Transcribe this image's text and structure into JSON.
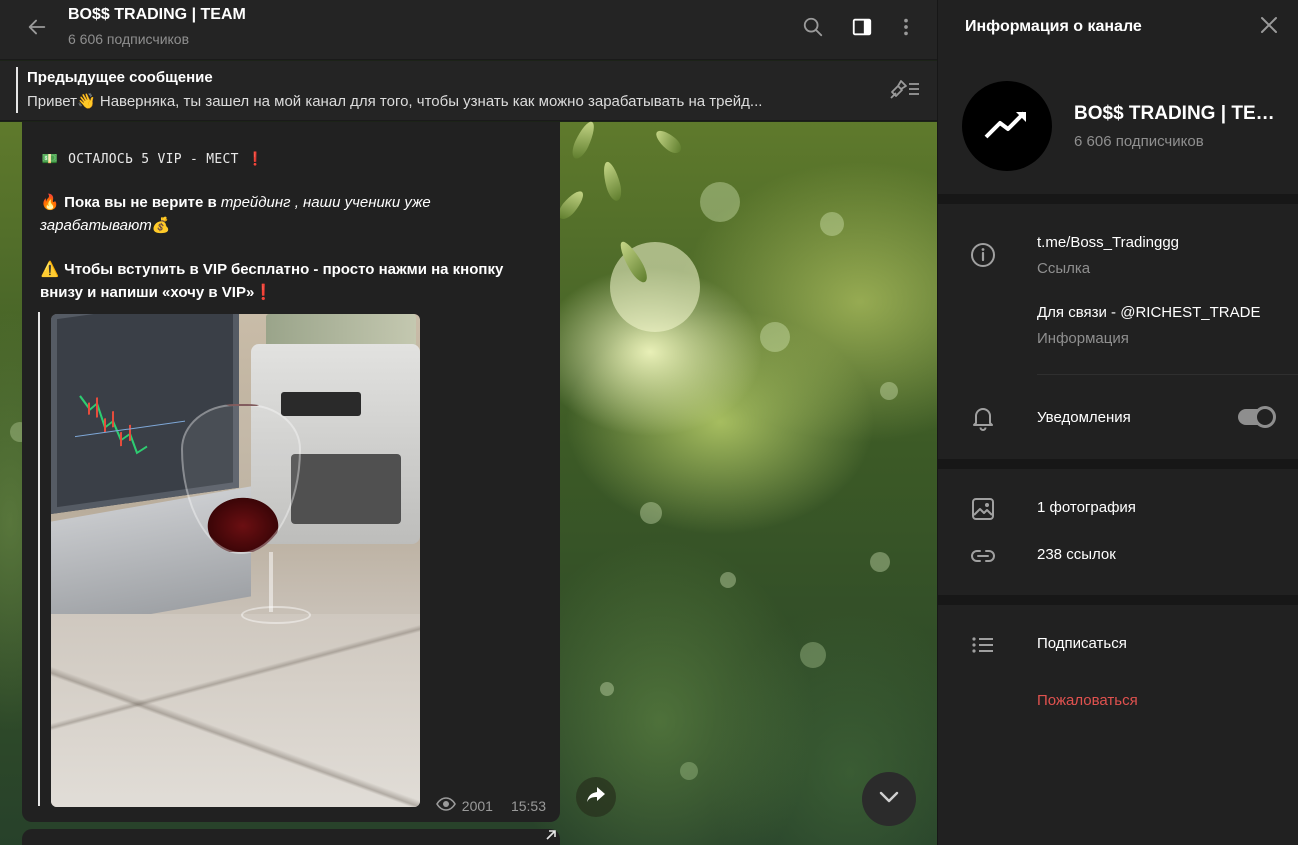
{
  "header": {
    "title": "BO$$ TRADING | TEAM",
    "subscribers": "6 606 подписчиков"
  },
  "pinned": {
    "label": "Предыдущее сообщение",
    "text": "Привет👋    Наверняка, ты зашел на мой канал для того, чтобы узнать как можно зарабатывать на трейд..."
  },
  "message": {
    "line1_emoji": "💵",
    "line1_text": "ОСТАЛОСЬ 5 VIP - МЕСТ",
    "line1_end": "❗",
    "line2_emoji": "🔥",
    "line2_bold": "Пока вы не верите в",
    "line2_italic": "трейдинг , наши ученики уже",
    "line2_italic2": "зарабатывают",
    "line2_end": "💰",
    "line3_emoji": "⚠️",
    "line3_bold": "Чтобы вступить в VIP бесплатно - просто нажми на кнопку",
    "line3_bold2": "внизу и напиши «хочу в VIP»",
    "line3_end": "❗",
    "views": "2001",
    "time": "15:53"
  },
  "panel": {
    "title": "Информация о канале",
    "name": "BO$$ TRADING | TEAM",
    "subscribers": "6 606 подписчиков",
    "link": "t.me/Boss_Tradinggg",
    "link_label": "Ссылка",
    "contact": "Для связи - @RICHEST_TRADE",
    "contact_label": "Информация",
    "notifications": "Уведомления",
    "notifications_on": true,
    "photos": "1 фотография",
    "links": "238 ссылок",
    "subscribe": "Подписаться",
    "report": "Пожаловаться"
  },
  "colors": {
    "panel_bg": "#212121",
    "bubble_bg": "#212121",
    "danger": "#e0524f",
    "muted": "#8f8f8f"
  },
  "icons": {
    "back": "arrow-left-icon",
    "search": "search-icon",
    "sidebar": "sidebar-toggle-icon",
    "more": "more-vertical-icon",
    "pin_list": "pin-list-icon",
    "close": "close-icon",
    "avatar": "trend-arrow-icon",
    "info": "info-icon",
    "bell": "bell-icon",
    "photo": "photo-icon",
    "link": "link-icon",
    "list": "list-icon",
    "views": "eye-icon",
    "forward": "forward-icon",
    "scroll_down": "chevron-down-icon"
  }
}
